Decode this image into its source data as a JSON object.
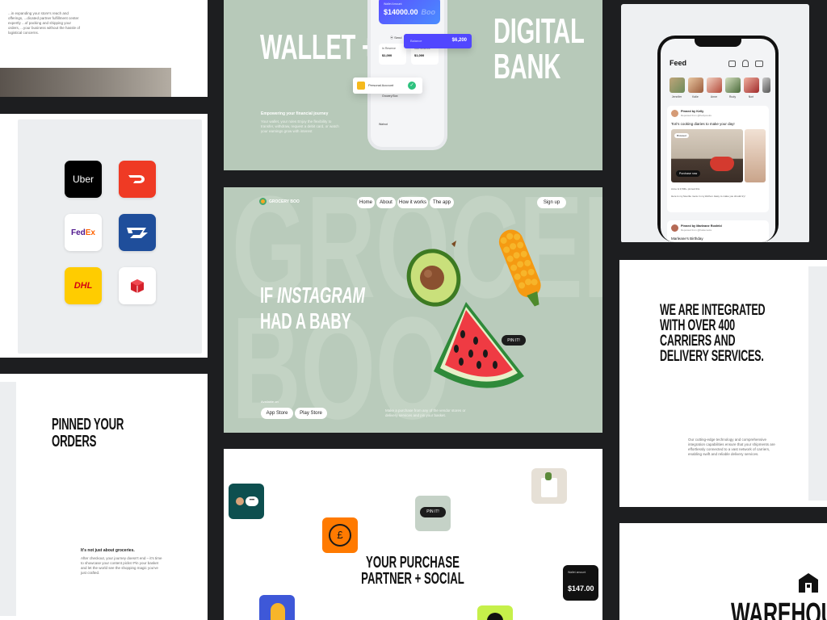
{
  "panel_top_left": {
    "paragraph": "...in expanding your store's reach and offerings, ...dicated partner fulfillment center expertly ...of packing and shipping your orders, ...your business without the hassle of logistical concerns."
  },
  "carriers": {
    "items": [
      {
        "name": "Uber",
        "bg": "#000000",
        "fg": "#ffffff"
      },
      {
        "name": "DoorDash",
        "bg": "#ef3a24",
        "fg": "#ffffff"
      },
      {
        "name": "FedEx",
        "bg": "#ffffff",
        "fg": "#4d148c"
      },
      {
        "name": "USPS",
        "bg": "#1f4e9b",
        "fg": "#ffffff"
      },
      {
        "name": "DHL",
        "bg": "#ffcc00",
        "fg": "#d40511"
      },
      {
        "name": "Parcel",
        "bg": "#ffffff",
        "fg": "#d4202a"
      }
    ]
  },
  "pinned": {
    "title_line1": "PINNED YOUR",
    "title_line2": "ORDERS",
    "subtitle": "It's not just about groceries.",
    "body": "After checkout, your journey doesn't end – it's time to showcase your content picks! Pin your basket and let the world see the shopping magic you've just crafted."
  },
  "wallet": {
    "headline_left": "WALLET +",
    "headline_right_1": "DIGITAL",
    "headline_right_2": "BANK",
    "tagline": "Empowering your financial journey",
    "body": "Your wallet, your rules Enjoy the flexibility to transfer, withdraw, request a debit card, or watch your earnings grow with interest",
    "card_label": "Wallet Amount",
    "card_amount": "$14000.00",
    "card_brand": "Boo",
    "balance_label": "Balance",
    "balance_amount": "$6,200",
    "personal_account": "Personal Account",
    "in_reserve": "In Reserve",
    "in_reserve_value": "$1,000",
    "job_reserve": "Job Reserve",
    "job_reserve_value": "$1,000",
    "row_grocery": "Grocery Box",
    "row_withdraw": "Walnut",
    "send_label": "Send"
  },
  "landing": {
    "brand": "GROCERY BOO",
    "nav": [
      "Home",
      "About",
      "How it works",
      "The app"
    ],
    "signup": "Sign up",
    "headline_1_prefix": "IF ",
    "headline_1_em": "INSTAGRAM",
    "headline_2": "HAD A BABY",
    "available_on": "Available on",
    "app_store": "App Store",
    "play_store": "Play Store",
    "description": "Make a purchase from any of the vendor stores or delivery services and pin your basket.",
    "pin_label": "PIN IT!",
    "watermark": "GROCERY BOO"
  },
  "purchase": {
    "headline_1": "YOUR PURCHASE",
    "headline_2": "PARTNER + SOCIAL",
    "pin_label": "PIN IT!",
    "currency_symbol": "£",
    "wallet_label": "Wallet amount",
    "wallet_amount": "$147.00"
  },
  "feed": {
    "title": "Feed",
    "stories": [
      "Jennifer",
      "Kalie",
      "Anne",
      "Rudy",
      "Nori",
      "Kate"
    ],
    "post1_author": "Pinned by Kelly",
    "post1_meta": "Reposted from @Kellycooks",
    "post1_text": "Tori's cooking diaries to make your day!",
    "post1_badge": "Browsed",
    "post1_cta": "Purchase now",
    "post1_likes": "Anne & 3,500+ pinned this",
    "post1_body": "Here is my favorite menu in my kitchen. Easy to make you should try!",
    "post2_author": "Pinned by Marleane Rosfeld",
    "post2_meta": "Reposted from @Kaliecooks",
    "post2_text": "Marleane's Birthday"
  },
  "integrated": {
    "title_line1": "WE ARE INTEGRATED",
    "title_line2": "WITH OVER 400",
    "title_line3": "CARRIERS AND",
    "title_line4": "DELIVERY SERVICES.",
    "body": "Our cutting-edge technology and comprehensive integration capabilities ensure that your shipments are effortlessly connected to a vast network of carriers, enabling swift and reliable delivery services."
  },
  "warehouse": {
    "title": "WAREHOUS"
  }
}
